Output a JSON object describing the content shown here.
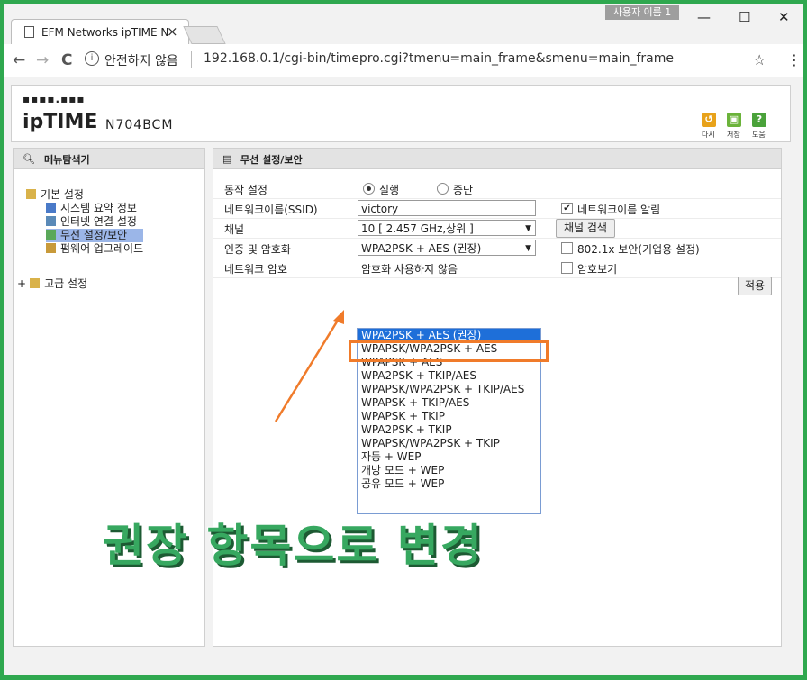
{
  "browser": {
    "tab_title": "EFM Networks ipTIME N",
    "tab_close": "×",
    "profile_name": "사용자 이름 1",
    "window_min": "—",
    "window_max": "☐",
    "window_close": "✕",
    "nav_back": "←",
    "nav_forward": "→",
    "nav_reload": "C",
    "security_text": "안전하지 않음",
    "url": "192.168.0.1/cgi-bin/timepro.cgi?tmenu=main_frame&smenu=main_frame",
    "bookmark_icon": "☆",
    "menu_icon": "⋮"
  },
  "header": {
    "logo_dots": "▪▪▪▪.▪▪▪",
    "logo": "ipTIME",
    "model": "N704BCM",
    "buttons": [
      {
        "label": "다시",
        "icon": "refresh-icon",
        "color": "#e8a21a"
      },
      {
        "label": "저장",
        "icon": "save-icon",
        "color": "#6bb33a"
      },
      {
        "label": "도움",
        "icon": "help-icon",
        "color": "#4aa23a"
      }
    ]
  },
  "left_panel": {
    "title": "메뉴탐색기",
    "groups": [
      {
        "label": "기본 설정",
        "items": [
          "시스템 요약 정보",
          "인터넷 연결 설정",
          "무선 설정/보안",
          "펌웨어 업그레이드"
        ]
      },
      {
        "label": "고급 설정",
        "expand": "+"
      }
    ],
    "selected_item": "무선 설정/보안"
  },
  "main_panel": {
    "title": "무선 설정/보안",
    "rows": {
      "operation": {
        "label": "동작 설정",
        "run": "실행",
        "stop": "중단"
      },
      "ssid": {
        "label": "네트워크이름(SSID)",
        "value": "victory",
        "checkbox_label": "네트워크이름 알림"
      },
      "channel": {
        "label": "채널",
        "value": "10 [ 2.457 GHz,상위 ]",
        "button": "채널 검색"
      },
      "auth": {
        "label": "인증 및 암호화",
        "value": "WPA2PSK + AES (권장)",
        "checkbox_label": "802.1x 보안(기업용 설정)"
      },
      "password": {
        "label": "네트워크 암호",
        "value": "암호화 사용하지 않음",
        "checkbox_label": "암호보기"
      }
    },
    "apply_button": "적용",
    "dropdown_options": [
      "WPA2PSK + AES (권장)",
      "WPAPSK/WPA2PSK + AES",
      "WPAPSK + AES",
      "WPA2PSK + TKIP/AES",
      "WPAPSK/WPA2PSK + TKIP/AES",
      "WPAPSK + TKIP/AES",
      "WPAPSK + TKIP",
      "WPA2PSK + TKIP",
      "WPAPSK/WPA2PSK + TKIP",
      "자동 + WEP",
      "개방 모드 + WEP",
      "공유 모드 + WEP"
    ],
    "highlighted_option": "WPA2PSK + AES (권장)"
  },
  "annotation": {
    "caption": "권장 항목으로 변경",
    "highlight_color": "#f07b2a",
    "caption_color": "#37a860"
  }
}
